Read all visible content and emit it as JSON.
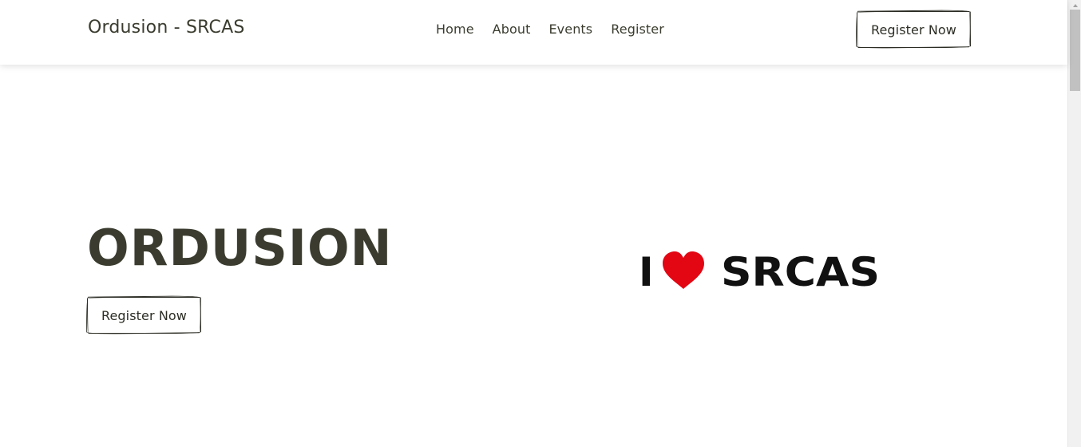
{
  "navbar": {
    "brand": "Ordusion - SRCAS",
    "links": [
      "Home",
      "About",
      "Events",
      "Register"
    ],
    "cta_label": "Register Now"
  },
  "hero": {
    "title": "ORDUSION",
    "cta_label": "Register Now",
    "logo": {
      "letter_i": "I",
      "word": "SRCAS",
      "heart_icon": "heart-icon",
      "heart_color": "#e30613",
      "text_color": "#111111"
    }
  },
  "colors": {
    "text": "#3b3c2f",
    "background": "#ffffff"
  }
}
